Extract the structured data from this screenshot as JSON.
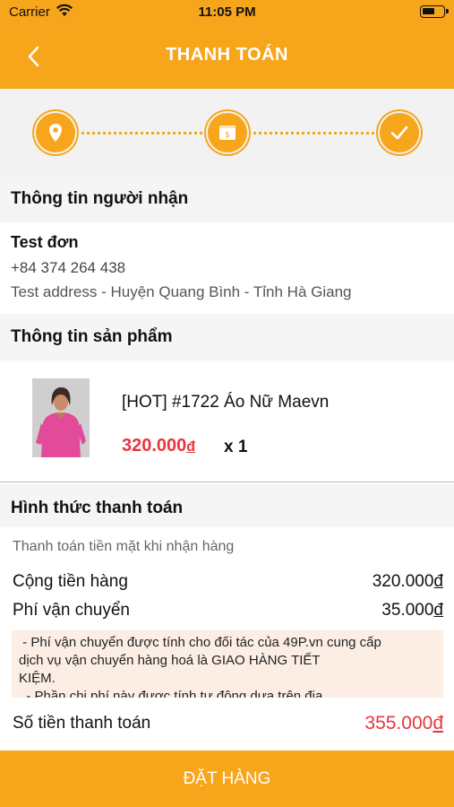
{
  "status_bar": {
    "carrier": "Carrier",
    "time": "11:05 PM"
  },
  "nav": {
    "title": "THANH TOÁN"
  },
  "colors": {
    "accent": "#f7a61b",
    "price_red": "#e8353d",
    "note_bg": "#fdeee5"
  },
  "steps": [
    {
      "icon": "location-pin-icon"
    },
    {
      "icon": "payment-icon"
    },
    {
      "icon": "checkmark-icon"
    }
  ],
  "recipient": {
    "section_title": "Thông tin người nhận",
    "name": "Test đơn",
    "phone": "+84 374 264 438",
    "address": "Test address - Huyện Quang Bình - Tỉnh Hà Giang"
  },
  "product": {
    "section_title": "Thông tin sản phẩm",
    "name": "[HOT] #1722 Áo Nữ Maevn",
    "price": "320.000",
    "currency": "đ",
    "quantity": "x 1"
  },
  "payment": {
    "section_title": "Hình thức thanh toán",
    "method": "Thanh toán tiền mặt khi nhận hàng",
    "subtotal_label": "Cộng tiền hàng",
    "subtotal_value": "320.000",
    "shipping_label": "Phí vận chuyển",
    "shipping_value": "35.000",
    "note_lines": [
      " - Phí vận chuyển được tính cho đối tác của 49P.vn cung cấp",
      "dịch vụ vận chuyển hàng hoá là GIAO HÀNG TIẾT",
      "KIỆM.",
      "  - Phần chi phí này được tính tự động dựa trên địa"
    ],
    "total_label": "Số tiền thanh toán",
    "total_value": "355.000",
    "currency": "đ"
  },
  "order_button": {
    "label": "ĐẶT HÀNG"
  }
}
